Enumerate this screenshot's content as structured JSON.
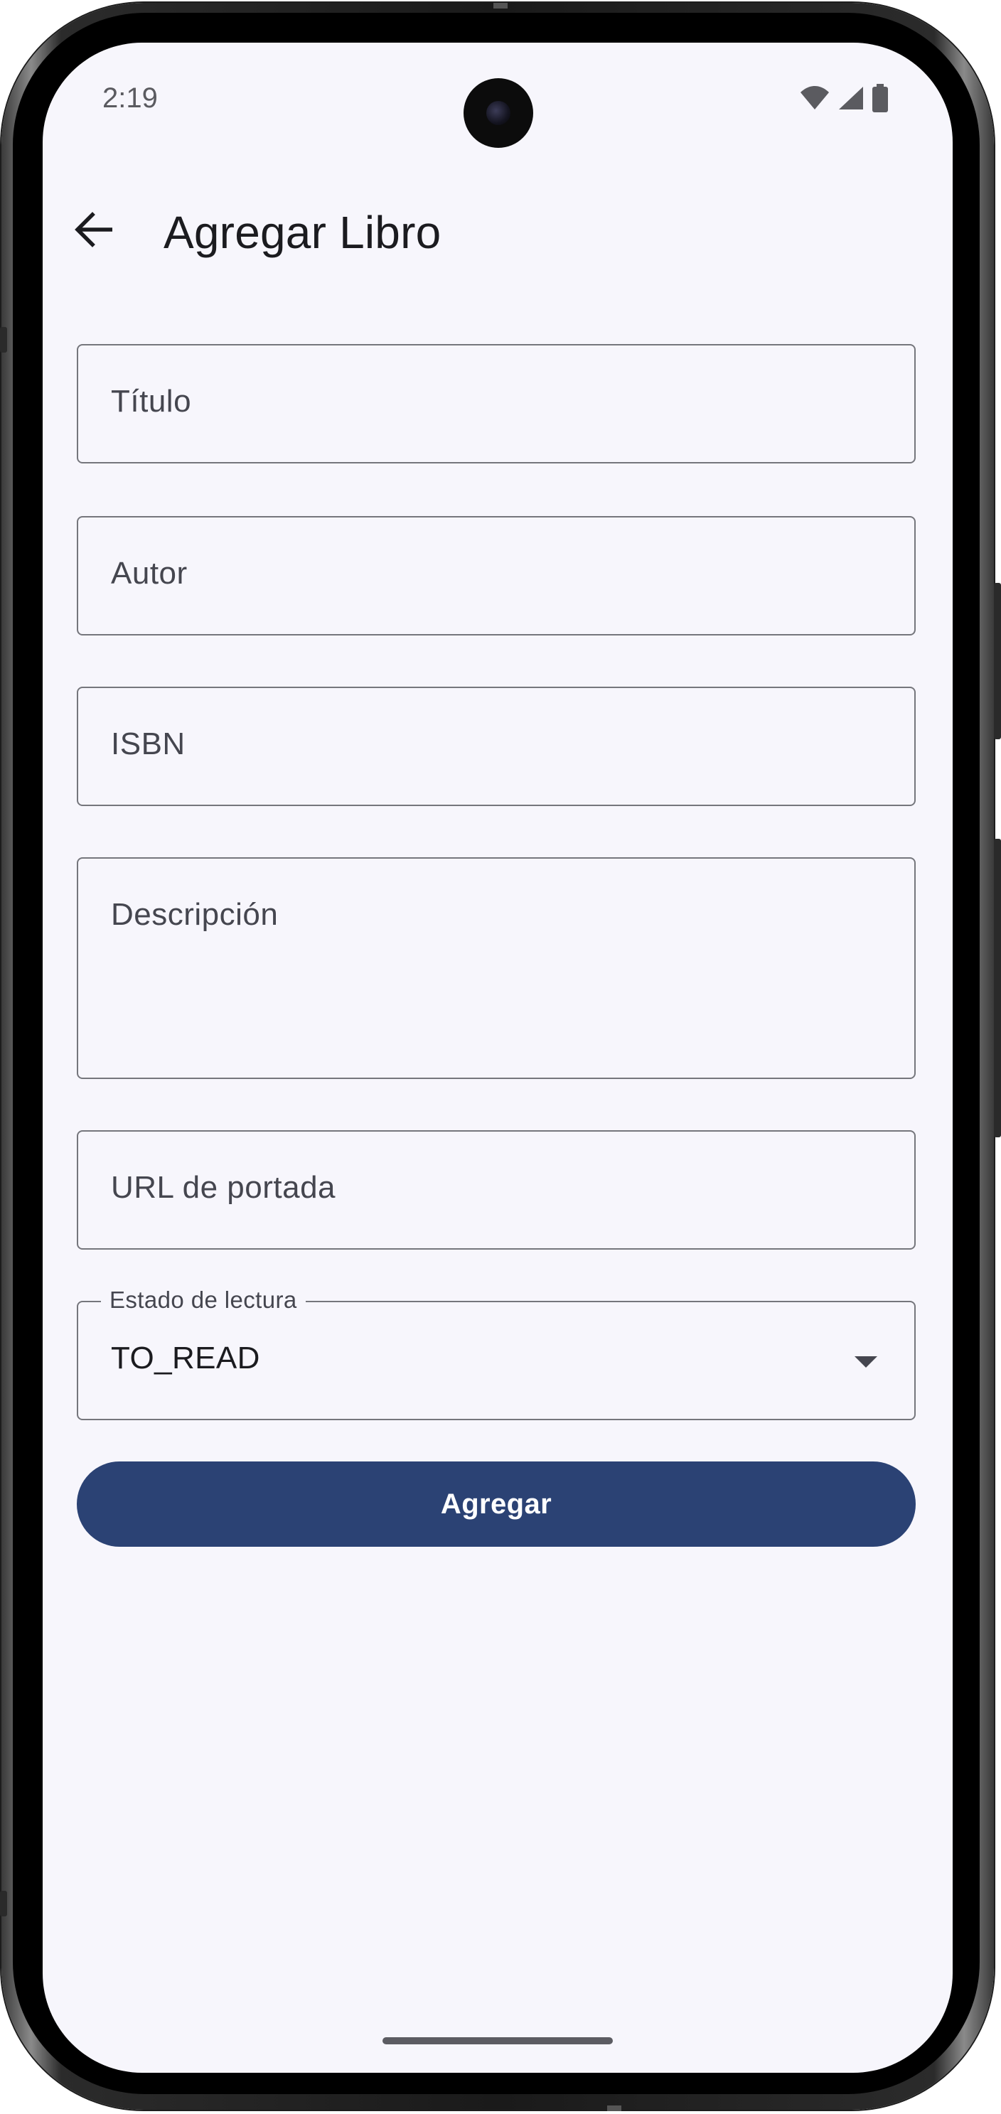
{
  "status_bar": {
    "time": "2:19",
    "icons": [
      "wifi-icon",
      "signal-icon",
      "battery-icon"
    ]
  },
  "app_bar": {
    "back_icon": "arrow-back-icon",
    "title": "Agregar Libro"
  },
  "form": {
    "title_field": {
      "label": "Título",
      "value": ""
    },
    "author_field": {
      "label": "Autor",
      "value": ""
    },
    "isbn_field": {
      "label": "ISBN",
      "value": ""
    },
    "description_field": {
      "label": "Descripción",
      "value": ""
    },
    "cover_url_field": {
      "label": "URL de portada",
      "value": ""
    },
    "reading_status": {
      "label": "Estado de lectura",
      "value": "TO_READ",
      "icon": "dropdown-arrow-icon"
    },
    "submit_label": "Agregar"
  },
  "colors": {
    "background": "#f7f6fc",
    "primary": "#2b4274",
    "outline": "#75767c",
    "on_surface": "#1b1b1f",
    "on_surface_variant": "#45464f"
  }
}
